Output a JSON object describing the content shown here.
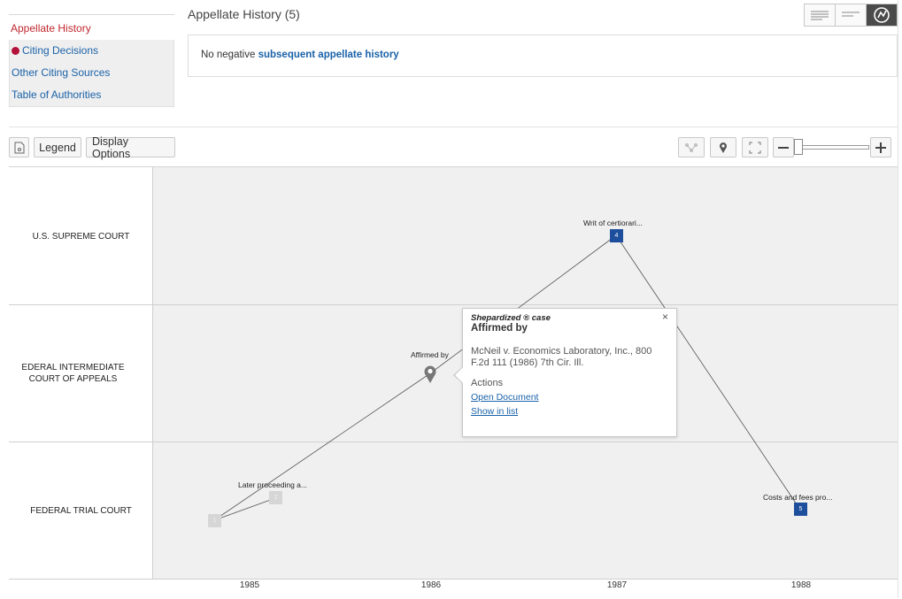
{
  "sidebar": {
    "items": [
      {
        "label": "Appellate History"
      },
      {
        "label": "Citing Decisions"
      },
      {
        "label": "Other Citing Sources"
      },
      {
        "label": "Table of Authorities"
      }
    ]
  },
  "header": {
    "title": "Appellate History (5)",
    "history_prefix": "No negative ",
    "history_link": "subsequent appellate history"
  },
  "toolbar": {
    "legend_label": "Legend",
    "display_options_label": "Display Options",
    "zoom_level": 0.07
  },
  "graph": {
    "lanes": [
      {
        "label": "U.S. SUPREME COURT"
      },
      {
        "label": "EDERAL INTERMEDIATE COURT OF APPEALS"
      },
      {
        "label": "FEDERAL TRIAL COURT"
      }
    ],
    "years": [
      "1985",
      "1986",
      "1987",
      "1988"
    ],
    "nodes": [
      {
        "id": "1",
        "label": "",
        "color": "#d6d6d6"
      },
      {
        "id": "2",
        "label": "Later proceeding a...",
        "color": "#d6d6d6"
      },
      {
        "id": "3",
        "label": "Affirmed by",
        "color": "#888888"
      },
      {
        "id": "4",
        "label": "Writ of certiorari...",
        "color": "#1e4f9c"
      },
      {
        "id": "5",
        "label": "Costs and fees pro...",
        "color": "#1e4f9c"
      }
    ]
  },
  "popup": {
    "kind": "Shepardized ® case",
    "title": "Affirmed by",
    "close": "×",
    "case": "McNeil v. Economics Laboratory, Inc., 800 F.2d 111 (1986) 7th Cir. Ill.",
    "actions_label": "Actions",
    "open_document": "Open Document",
    "show_in_list": "Show in list"
  },
  "colors": {
    "accent_blue": "#1a62a8",
    "active_red": "#c0272d",
    "node_blue": "#1e4f9c",
    "red_flag": "#b3123a"
  }
}
